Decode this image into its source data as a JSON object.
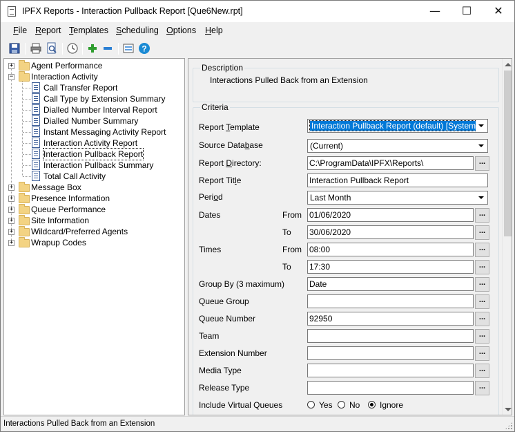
{
  "window": {
    "title": "IPFX Reports - Interaction Pullback Report  [Que6New.rpt]",
    "minimize_glyph": "—",
    "maximize_glyph": "☐",
    "close_glyph": "✕"
  },
  "menu": {
    "file": {
      "key": "F",
      "rest": "ile"
    },
    "report": {
      "key": "R",
      "rest": "eport"
    },
    "templates": {
      "key": "T",
      "rest": "emplates"
    },
    "scheduling": {
      "key": "S",
      "rest": "cheduling"
    },
    "options": {
      "key": "O",
      "rest": "ptions"
    },
    "help": {
      "key": "H",
      "rest": "elp"
    }
  },
  "toolbar": {
    "icons": [
      "save-icon",
      "print-icon",
      "print-preview-icon",
      "schedule-clock-icon",
      "add-icon",
      "remove-icon",
      "refresh-icon",
      "help-icon"
    ]
  },
  "tree": {
    "folders_top": [
      {
        "label": "Agent Performance",
        "expanded": false
      },
      {
        "label": "Interaction Activity",
        "expanded": true
      }
    ],
    "reports": [
      "Call Transfer Report",
      "Call Type by Extension Summary",
      "Dialled Number Interval Report",
      "Dialled Number Summary",
      "Instant Messaging Activity Report",
      "Interaction Activity Report",
      "Interaction Pullback Report",
      "Interaction Pullback Summary",
      "Total Call Activity"
    ],
    "selected_report": "Interaction Pullback Report",
    "folders_bottom": [
      "Message Box",
      "Presence Information",
      "Queue Performance",
      "Site Information",
      "Wildcard/Preferred Agents",
      "Wrapup Codes"
    ],
    "expander_plus": "+",
    "expander_minus": "−"
  },
  "description": {
    "title": "Description",
    "text": "Interactions Pulled Back from an Extension"
  },
  "criteria": {
    "title": "Criteria",
    "report_template": {
      "label_pre": "Report ",
      "label_key": "T",
      "label_post": "emplate",
      "value": "Interaction Pullback Report (default) [System]"
    },
    "source_database": {
      "label_pre": "Source Data",
      "label_key": "b",
      "label_post": "ase",
      "value": "(Current)"
    },
    "report_directory": {
      "label_pre": "Report ",
      "label_key": "D",
      "label_post": "irectory:",
      "value": "C:\\ProgramData\\IPFX\\Reports\\"
    },
    "report_title": {
      "label_pre": "Report Tit",
      "label_key": "l",
      "label_post": "e",
      "value": "Interaction Pullback Report"
    },
    "period": {
      "label_pre": "Peri",
      "label_key": "o",
      "label_post": "d",
      "value": "Last Month"
    },
    "dates": {
      "label": "Dates",
      "from_label": "From",
      "to_label": "To",
      "from": "01/06/2020",
      "to": "30/06/2020"
    },
    "times": {
      "label": "Times",
      "from_label": "From",
      "to_label": "To",
      "from": "08:00",
      "to": "17:30"
    },
    "group_by": {
      "label": "Group By (3 maximum)",
      "value": "Date"
    },
    "queue_group": {
      "label": "Queue Group",
      "value": ""
    },
    "queue_number": {
      "label": "Queue Number",
      "value": "92950"
    },
    "team": {
      "label": "Team",
      "value": ""
    },
    "extension_number": {
      "label": "Extension Number",
      "value": ""
    },
    "media_type": {
      "label": "Media Type",
      "value": ""
    },
    "release_type": {
      "label": "Release Type",
      "value": ""
    },
    "include_virtual_queues": {
      "label": "Include Virtual Queues",
      "options": [
        "Yes",
        "No",
        "Ignore"
      ],
      "selected": "Ignore"
    },
    "browse_label": "..."
  },
  "status": {
    "text": "Interactions Pulled Back from an Extension"
  }
}
